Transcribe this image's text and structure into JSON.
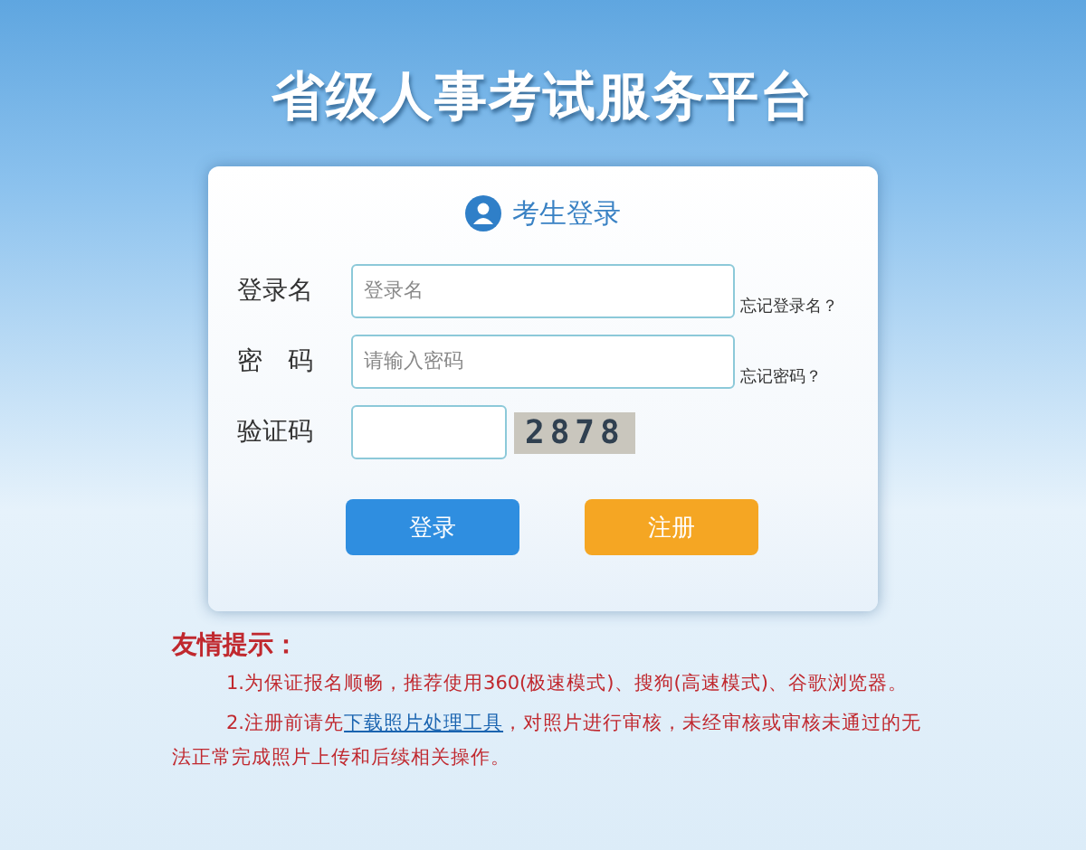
{
  "title": "省级人事考试服务平台",
  "login": {
    "heading": "考生登录",
    "fields": [
      {
        "label": "登录名",
        "placeholder": "登录名",
        "help": "忘记登录名？"
      },
      {
        "label": "密　码",
        "placeholder": "请输入密码",
        "help": "忘记密码？"
      }
    ],
    "captcha": {
      "label": "验证码",
      "code": "2878"
    },
    "buttons": [
      {
        "label": "登录",
        "kind": "primary"
      },
      {
        "label": "注册",
        "kind": "secondary"
      }
    ]
  },
  "tips": {
    "heading": "友情提示：",
    "items": [
      {
        "before": "1.为保证报名顺畅，推荐使用360(极速模式)、搜狗(高速模式)、谷歌浏览器。"
      },
      {
        "before": "2.注册前请先",
        "link": "下载照片处理工具",
        "after": "，对照片进行审核，未经审核或审核未通过的无法正常完成照片上传和后续相关操作。"
      }
    ]
  }
}
